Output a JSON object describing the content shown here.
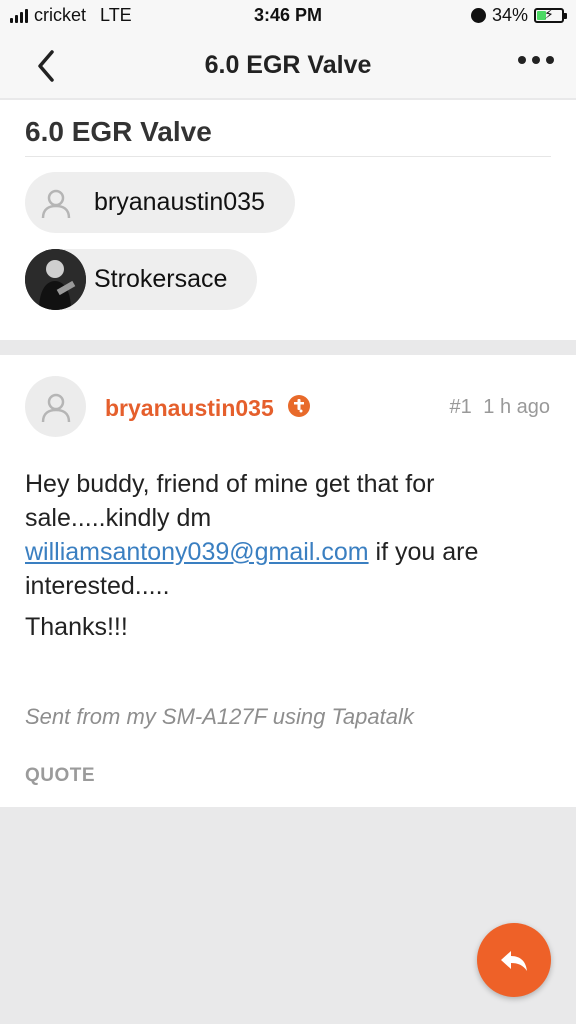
{
  "status_bar": {
    "carrier": "cricket",
    "network": "LTE",
    "time": "3:46 PM",
    "battery": "34%",
    "battery_level": 0.34,
    "icons": [
      "signal-icon",
      "alarm-icon",
      "battery-charging-icon"
    ]
  },
  "nav": {
    "title": "6.0 EGR Valve",
    "back_icon": "chevron-left-icon",
    "more_icon": "ellipsis-icon"
  },
  "thread": {
    "title": "6.0 EGR Valve",
    "participants": [
      {
        "name": "bryanaustin035",
        "avatar": "default-user-icon"
      },
      {
        "name": "Strokersace",
        "avatar": "photo-avatar"
      }
    ]
  },
  "post": {
    "author": "bryanaustin035",
    "badge_icon": "tapatalk-badge-icon",
    "number": "#1",
    "time": "1 h ago",
    "body_prefix": "Hey buddy, friend of mine get that for sale.....kindly dm",
    "email": "williamsantony039@gmail.com",
    "body_suffix": "if you are interested.....",
    "thanks": "Thanks!!!",
    "signature": "Sent from my SM-A127F using Tapatalk",
    "quote_label": "QUOTE"
  },
  "fab": {
    "icon": "reply-icon"
  },
  "colors": {
    "accent": "#e55f2c",
    "fab": "#ee6128",
    "link": "#3a7fc1",
    "background": "#e9e9ea"
  }
}
